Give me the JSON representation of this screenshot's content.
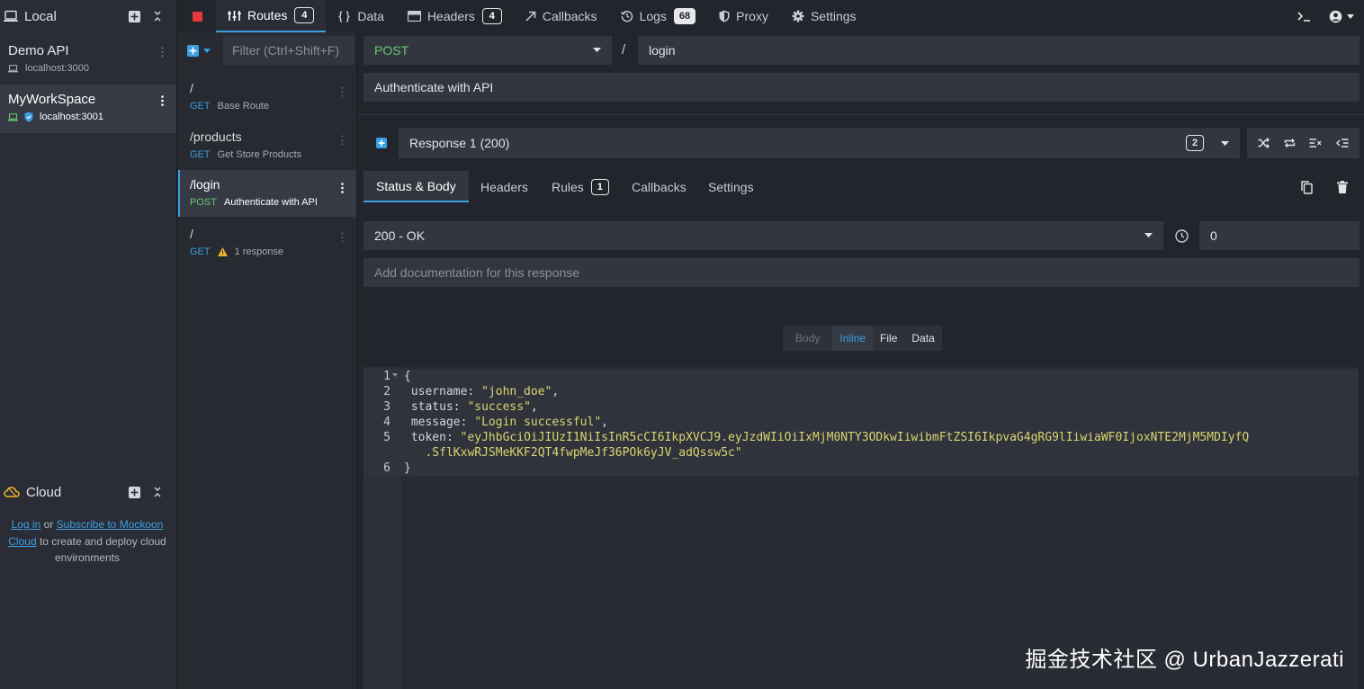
{
  "environments": {
    "local_title": "Local",
    "items": [
      {
        "name": "Demo API",
        "host": "localhost:3000"
      },
      {
        "name": "MyWorkSpace",
        "host": "localhost:3001"
      }
    ],
    "cloud_title": "Cloud",
    "cloud_text": {
      "login": "Log in",
      "or": " or ",
      "subscribe": "Subscribe to Mockoon Cloud",
      "rest": " to create and deploy cloud environments"
    }
  },
  "topnav": {
    "tabs": [
      {
        "label": "Routes",
        "badge": "4"
      },
      {
        "label": "Data"
      },
      {
        "label": "Headers",
        "badge": "4"
      },
      {
        "label": "Callbacks"
      },
      {
        "label": "Logs",
        "badge": "68"
      },
      {
        "label": "Proxy"
      },
      {
        "label": "Settings"
      }
    ]
  },
  "routes": {
    "filter_placeholder": "Filter (Ctrl+Shift+F)",
    "items": [
      {
        "path": "/",
        "method": "GET",
        "desc": "Base Route"
      },
      {
        "path": "/products",
        "method": "GET",
        "desc": "Get Store Products"
      },
      {
        "path": "/login",
        "method": "POST",
        "desc": "Authenticate with API"
      },
      {
        "path": "/",
        "method": "GET",
        "desc": "1 response"
      }
    ]
  },
  "route_editor": {
    "method": "POST",
    "path_sep": "/",
    "path": "login",
    "documentation": "Authenticate with API"
  },
  "response": {
    "selected": "Response 1 (200)",
    "count": "2",
    "tabs": [
      {
        "label": "Status & Body"
      },
      {
        "label": "Headers"
      },
      {
        "label": "Rules",
        "badge": "1"
      },
      {
        "label": "Callbacks"
      },
      {
        "label": "Settings"
      }
    ],
    "status": "200 - OK",
    "latency": "0",
    "doc_placeholder": "Add documentation for this response",
    "body_modes": [
      "Body",
      "Inline",
      "File",
      "Data"
    ]
  },
  "editor": {
    "line_numbers": [
      "1",
      "2",
      "3",
      "4",
      "5",
      "",
      "6"
    ],
    "lines": [
      {
        "plain": "{"
      },
      {
        "key": " username: ",
        "str": "\"john_doe\"",
        "tail": ","
      },
      {
        "key": " status: ",
        "str": "\"success\"",
        "tail": ","
      },
      {
        "key": " message: ",
        "str": "\"Login successful\"",
        "tail": ","
      },
      {
        "key": " token: ",
        "str": "\"eyJhbGciOiJIUzI1NiIsInR5cCI6IkpXVCJ9.eyJzdWIiOiIxMjM0NTY3ODkwIiwibmFtZSI6IkpvaG4gRG9lIiwiaWF0IjoxNTE2MjM5MDIyfQ",
        "tail": ""
      },
      {
        "str": "   .SflKxwRJSMeKKF2QT4fwpMeJf36POk6yJV_adQssw5c\"",
        "tail": ""
      },
      {
        "plain": "}"
      }
    ]
  },
  "watermark": "掘金技术社区 @ UrbanJazzerati",
  "colors": {
    "accent": "#3a9fe3",
    "post": "#68c774",
    "string": "#d9d66f",
    "stop": "#e5393d",
    "warning": "#f0b429"
  }
}
